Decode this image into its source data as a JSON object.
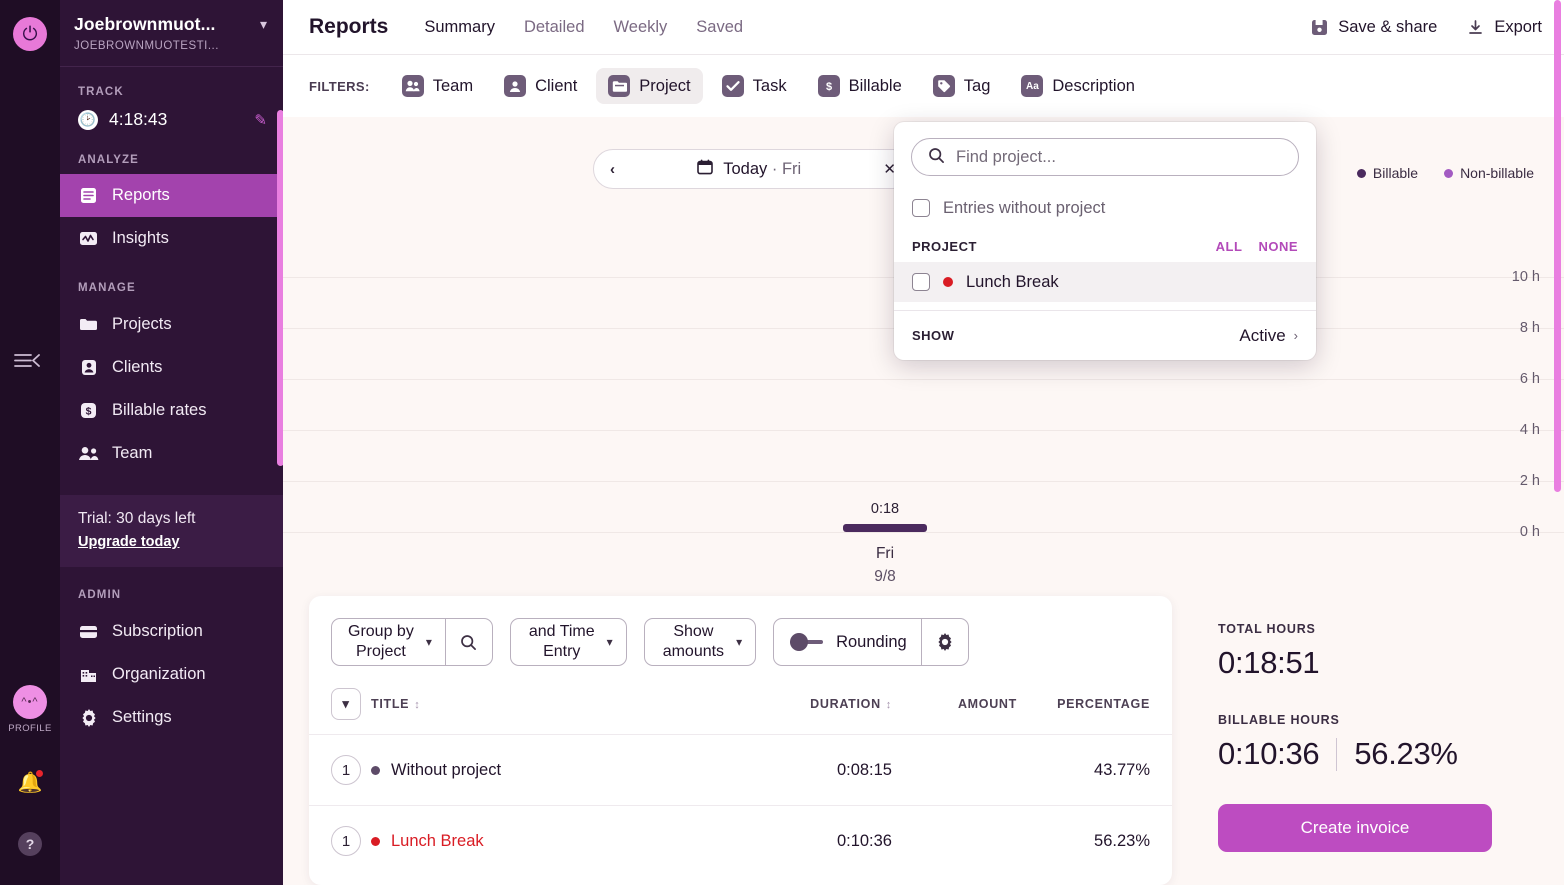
{
  "colors": {
    "rail_bg": "#1f0d25",
    "sidebar_bg": "#2e1436",
    "accent_pink": "#e97fe0",
    "active_nav": "#a343ad",
    "billable": "#4b2a5e",
    "non_billable": "#a35bc2",
    "project_red": "#d91c24",
    "without_project_gray": "#5d4b68",
    "create_invoice": "#bd4cc1",
    "page_bg": "#fdf7f5"
  },
  "rail": {
    "power_icon": "power-icon",
    "collapse_icon": "collapse-sidebar-icon",
    "profile_label": "PROFILE",
    "avatar_icon": "avatar-face",
    "bell_icon": "notifications-bell-icon",
    "help_icon": "help-icon",
    "help_glyph": "?"
  },
  "sidebar": {
    "workspace_name": "Joebrownmuot...",
    "workspace_sub": "JOEBROWNMUOTESTI...",
    "caret_icon": "chevron-down-icon",
    "sections": [
      {
        "label": "TRACK",
        "timer": {
          "value": "4:18:43",
          "clock_icon": "clock-icon",
          "edit_icon": "pencil-icon"
        }
      },
      {
        "label": "ANALYZE",
        "items": [
          {
            "label": "Reports",
            "icon": "reports-icon",
            "glyph": "☷",
            "active": true
          },
          {
            "label": "Insights",
            "icon": "insights-icon",
            "glyph": "∿",
            "active": false
          }
        ]
      },
      {
        "label": "MANAGE",
        "items": [
          {
            "label": "Projects",
            "icon": "folder-icon",
            "glyph": "▰",
            "active": false
          },
          {
            "label": "Clients",
            "icon": "client-icon",
            "glyph": "■",
            "active": false
          },
          {
            "label": "Billable rates",
            "icon": "dollar-icon",
            "glyph": "$",
            "active": false
          },
          {
            "label": "Team",
            "icon": "team-icon",
            "glyph": "●",
            "active": false
          }
        ]
      },
      {
        "label": "ADMIN",
        "items": [
          {
            "label": "Subscription",
            "icon": "card-icon",
            "glyph": "▬",
            "active": false
          },
          {
            "label": "Organization",
            "icon": "building-icon",
            "glyph": "▦",
            "active": false
          },
          {
            "label": "Settings",
            "icon": "gear-icon",
            "glyph": "⚙",
            "active": false
          }
        ]
      }
    ],
    "trial": {
      "text": "Trial: 30 days left",
      "link": "Upgrade today"
    }
  },
  "header": {
    "title": "Reports",
    "tabs": [
      {
        "label": "Summary",
        "active": true
      },
      {
        "label": "Detailed",
        "active": false
      },
      {
        "label": "Weekly",
        "active": false
      },
      {
        "label": "Saved",
        "active": false
      }
    ],
    "actions": [
      {
        "label": "Save & share",
        "icon": "save-icon",
        "glyph": "💾"
      },
      {
        "label": "Export",
        "icon": "download-icon",
        "glyph": "⤓"
      }
    ]
  },
  "filters": {
    "label": "FILTERS:",
    "chips": [
      {
        "label": "Team",
        "icon": "team-filter-icon",
        "glyph": "👥",
        "open": false
      },
      {
        "label": "Client",
        "icon": "client-filter-icon",
        "glyph": "👤",
        "open": false
      },
      {
        "label": "Project",
        "icon": "project-filter-icon",
        "glyph": "▭",
        "open": true
      },
      {
        "label": "Task",
        "icon": "task-filter-icon",
        "glyph": "✓",
        "open": false
      },
      {
        "label": "Billable",
        "icon": "billable-filter-icon",
        "glyph": "$",
        "open": false
      },
      {
        "label": "Tag",
        "icon": "tag-filter-icon",
        "glyph": "◆",
        "open": false
      },
      {
        "label": "Description",
        "icon": "description-filter-icon",
        "glyph": "Aa",
        "open": false
      }
    ]
  },
  "project_dropdown": {
    "search_placeholder": "Find project...",
    "search_value": "",
    "search_icon": "search-icon",
    "entries_without_project": "Entries without project",
    "section_label": "PROJECT",
    "all_label": "ALL",
    "none_label": "NONE",
    "projects": [
      {
        "name": "Lunch Break",
        "color": "#d91c24",
        "checked": false,
        "highlighted": true
      }
    ],
    "show_label": "SHOW",
    "show_value": "Active",
    "show_chevron_icon": "chevron-right-icon"
  },
  "datebar": {
    "prev_icon": "chevron-left-icon",
    "calendar_icon": "calendar-icon",
    "label_main": "Today",
    "label_sep": " · ",
    "label_sub": "Fri",
    "clear_icon": "close-icon"
  },
  "chart_data": {
    "type": "bar",
    "title": "",
    "categories": [
      "Fri"
    ],
    "x_sublabels": [
      "9/8"
    ],
    "values": [
      0.3
    ],
    "data_labels": [
      "0:18"
    ],
    "ylabel": "",
    "ylim": [
      0,
      10
    ],
    "yticks": [
      10,
      8,
      6,
      4,
      2,
      0
    ],
    "ytick_labels": [
      "10 h",
      "8 h",
      "6 h",
      "4 h",
      "2 h",
      "0 h"
    ],
    "grid": true,
    "legend_position": "top-right",
    "series": [
      {
        "name": "Billable",
        "color": "#4b2a5e",
        "values": [
          0.18
        ]
      },
      {
        "name": "Non-billable",
        "color": "#a35bc2",
        "values": [
          0.12
        ]
      }
    ],
    "legend": [
      {
        "label": "Billable",
        "color": "#4b2a5e"
      },
      {
        "label": "Non-billable",
        "color": "#a35bc2"
      }
    ]
  },
  "report_tools": {
    "group_by": {
      "text_line1": "Group by",
      "text_line2": "Project",
      "chevron_icon": "chevron-down-icon",
      "search_icon": "search-icon"
    },
    "subgroup": {
      "text_line1": "and Time",
      "text_line2": "Entry",
      "chevron_icon": "chevron-down-icon"
    },
    "amounts": {
      "text_line1": "Show",
      "text_line2": "amounts",
      "chevron_icon": "chevron-down-icon"
    },
    "rounding": {
      "label": "Rounding",
      "enabled": false,
      "gear_icon": "gear-icon"
    }
  },
  "table": {
    "collapse_icon": "chevron-down-icon",
    "columns": [
      {
        "label": "TITLE",
        "sortable": true,
        "sort_icon": "sort-icon"
      },
      {
        "label": "DURATION",
        "sortable": true,
        "sort_icon": "sort-icon"
      },
      {
        "label": "AMOUNT",
        "sortable": false
      },
      {
        "label": "PERCENTAGE",
        "sortable": false
      }
    ],
    "rows": [
      {
        "count": "1",
        "title": "Without project",
        "color": "#5d4b68",
        "text_color": "#22142b",
        "duration": "0:08:15",
        "amount": "",
        "percentage": "43.77%"
      },
      {
        "count": "1",
        "title": "Lunch Break",
        "color": "#d91c24",
        "text_color": "#d91c24",
        "duration": "0:10:36",
        "amount": "",
        "percentage": "56.23%"
      }
    ]
  },
  "stats": {
    "total_hours_label": "TOTAL HOURS",
    "total_hours_value": "0:18:51",
    "billable_hours_label": "BILLABLE HOURS",
    "billable_hours_value": "0:10:36",
    "billable_percentage": "56.23%",
    "create_invoice_label": "Create invoice"
  }
}
